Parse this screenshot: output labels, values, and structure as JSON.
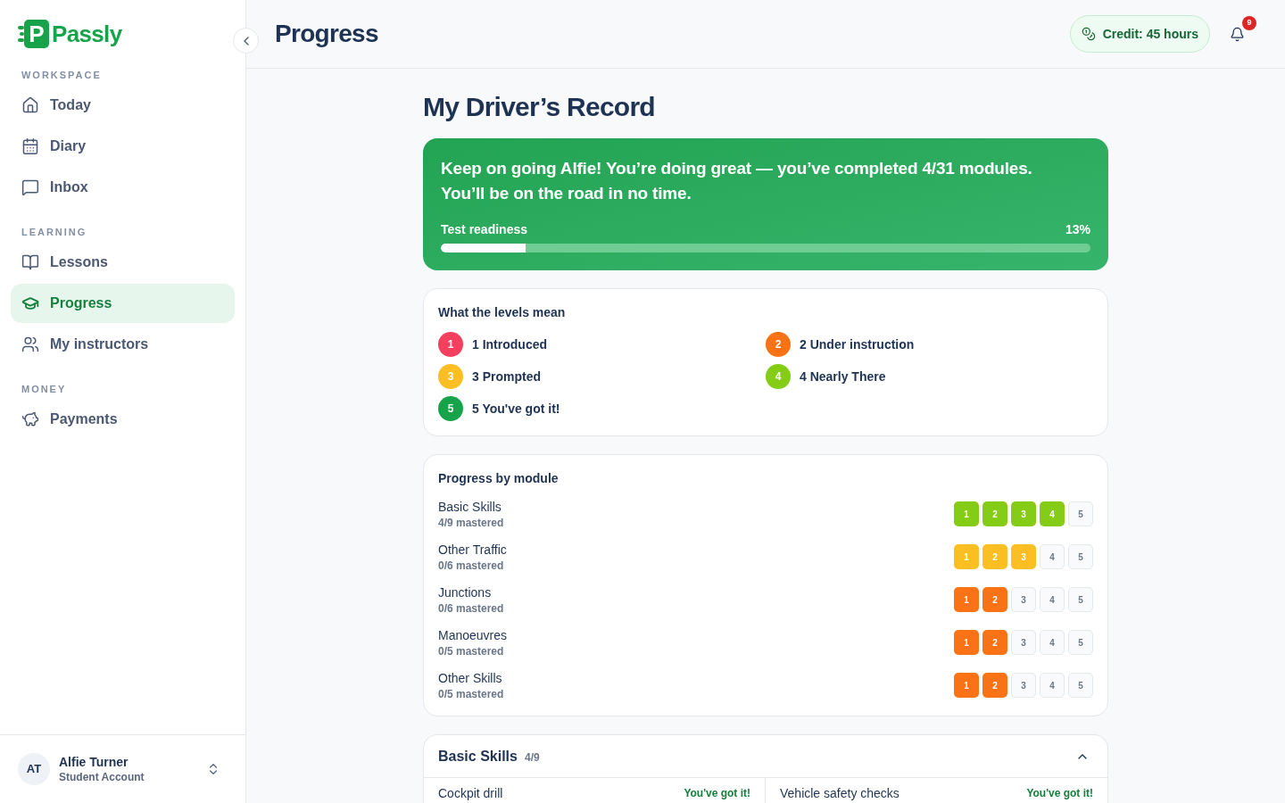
{
  "sidebar": {
    "logo": {
      "mark": "P",
      "name": "Passly"
    },
    "sections": [
      {
        "title": "WORKSPACE",
        "items": [
          {
            "label": "Today",
            "selected": false
          },
          {
            "label": "Diary",
            "selected": false
          },
          {
            "label": "Inbox",
            "selected": false
          }
        ]
      },
      {
        "title": "LEARNING",
        "items": [
          {
            "label": "Lessons",
            "selected": false
          },
          {
            "label": "Progress",
            "selected": true
          },
          {
            "label": "My instructors",
            "selected": false
          }
        ]
      },
      {
        "title": "MONEY",
        "items": [
          {
            "label": "Payments",
            "selected": false
          }
        ]
      }
    ],
    "user": {
      "initials": "AT",
      "name": "Alfie Turner",
      "role": "Student Account"
    }
  },
  "header": {
    "title": "Progress",
    "credit": "Credit: 45 hours",
    "notifications": "9"
  },
  "page_title": "My Driver’s Record",
  "banner": {
    "lines": [
      "Keep on going Alfie! You’re doing great — you’ve completed 4/31 modules.",
      "You’ll be on the road in no time."
    ],
    "readiness": {
      "label": "Test readiness",
      "reading": "13%",
      "level": 0.13
    }
  },
  "levels": {
    "title": "What the levels mean",
    "items": [
      {
        "number": "1",
        "label": "1 Introduced",
        "color": "#f43f5e"
      },
      {
        "number": "2",
        "label": "2 Under instruction",
        "color": "#f97316"
      },
      {
        "number": "3",
        "label": "3 Prompted",
        "color": "#fbbf24"
      },
      {
        "number": "4",
        "label": "4 Nearly There",
        "color": "#84cc16"
      },
      {
        "number": "5",
        "label": "5 You've got it!",
        "color": "#16a34a"
      }
    ]
  },
  "modules": {
    "title": "Progress by module",
    "rows": [
      {
        "name": "Basic Skills",
        "mastered": "4/9 mastered",
        "color": "#84cc16",
        "boxes": [
          {
            "label": "1",
            "filled": true
          },
          {
            "label": "2",
            "filled": true
          },
          {
            "label": "3",
            "filled": true
          },
          {
            "label": "4",
            "filled": true
          },
          {
            "label": "5",
            "filled": false
          }
        ]
      },
      {
        "name": "Other Traffic",
        "mastered": "0/6 mastered",
        "color": "#fbbf24",
        "boxes": [
          {
            "label": "1",
            "filled": true
          },
          {
            "label": "2",
            "filled": true
          },
          {
            "label": "3",
            "filled": true
          },
          {
            "label": "4",
            "filled": false
          },
          {
            "label": "5",
            "filled": false
          }
        ]
      },
      {
        "name": "Junctions",
        "mastered": "0/6 mastered",
        "color": "#f97316",
        "boxes": [
          {
            "label": "1",
            "filled": true
          },
          {
            "label": "2",
            "filled": true
          },
          {
            "label": "3",
            "filled": false
          },
          {
            "label": "4",
            "filled": false
          },
          {
            "label": "5",
            "filled": false
          }
        ]
      },
      {
        "name": "Manoeuvres",
        "mastered": "0/5 mastered",
        "color": "#f97316",
        "boxes": [
          {
            "label": "1",
            "filled": true
          },
          {
            "label": "2",
            "filled": true
          },
          {
            "label": "3",
            "filled": false
          },
          {
            "label": "4",
            "filled": false
          },
          {
            "label": "5",
            "filled": false
          }
        ]
      },
      {
        "name": "Other Skills",
        "mastered": "0/5 mastered",
        "color": "#f97316",
        "boxes": [
          {
            "label": "1",
            "filled": true
          },
          {
            "label": "2",
            "filled": true
          },
          {
            "label": "3",
            "filled": false
          },
          {
            "label": "4",
            "filled": false
          },
          {
            "label": "5",
            "filled": false
          }
        ]
      }
    ]
  },
  "detail": {
    "title": "Basic Skills",
    "count": "4/9",
    "expanded": true,
    "skills": [
      {
        "name": "Cockpit drill",
        "status": "You've got it!"
      },
      {
        "name": "Vehicle safety checks",
        "status": "You've got it!"
      }
    ]
  }
}
